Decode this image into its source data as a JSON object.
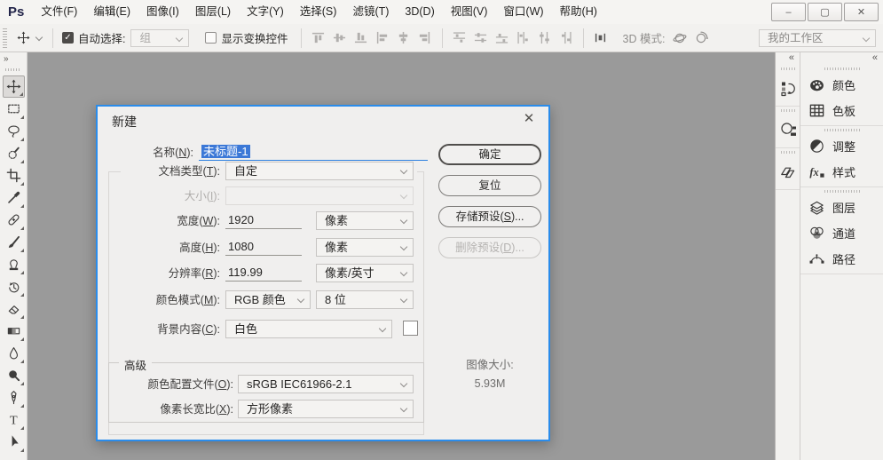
{
  "app": {
    "logo": "Ps"
  },
  "titlebar": {
    "menus": [
      {
        "id": "file",
        "label": "文件(F)"
      },
      {
        "id": "edit",
        "label": "编辑(E)"
      },
      {
        "id": "image",
        "label": "图像(I)"
      },
      {
        "id": "layer",
        "label": "图层(L)"
      },
      {
        "id": "type",
        "label": "文字(Y)"
      },
      {
        "id": "select",
        "label": "选择(S)"
      },
      {
        "id": "filter",
        "label": "滤镜(T)"
      },
      {
        "id": "3d",
        "label": "3D(D)"
      },
      {
        "id": "view",
        "label": "视图(V)"
      },
      {
        "id": "window",
        "label": "窗口(W)"
      },
      {
        "id": "help",
        "label": "帮助(H)"
      }
    ],
    "window_controls": {
      "minimize": "–",
      "maximize": "▢",
      "close": "✕"
    }
  },
  "options_bar": {
    "auto_select": {
      "label": "自动选择:",
      "checked": true,
      "checkmark": "✓"
    },
    "group_dropdown": {
      "value": "组",
      "disabled": true
    },
    "show_transform": {
      "label": "显示变换控件",
      "checked": false
    },
    "align_icons": [
      {
        "id": "align-top"
      },
      {
        "id": "align-vertical-center"
      },
      {
        "id": "align-bottom"
      },
      {
        "id": "align-left"
      },
      {
        "id": "align-horizontal-center"
      },
      {
        "id": "align-right"
      }
    ],
    "distribute_icons": [
      {
        "id": "distribute-top"
      },
      {
        "id": "distribute-vertical-center"
      },
      {
        "id": "distribute-bottom"
      },
      {
        "id": "distribute-left"
      },
      {
        "id": "distribute-horizontal-center"
      },
      {
        "id": "distribute-right"
      }
    ],
    "spacing_icon": {
      "id": "distribute-spacing"
    },
    "mode_3d_label": "3D 模式:",
    "mode_3d_icons": [
      {
        "id": "orbit-3d"
      },
      {
        "id": "roll-3d"
      }
    ],
    "workspace": {
      "value": "我的工作区"
    }
  },
  "toolbar": {
    "selected": "move",
    "tools": [
      {
        "id": "move"
      },
      {
        "id": "rectangular-marquee"
      },
      {
        "id": "lasso"
      },
      {
        "id": "quick-selection"
      },
      {
        "id": "crop"
      },
      {
        "id": "eyedropper"
      },
      {
        "id": "spot-healing-brush"
      },
      {
        "id": "brush"
      },
      {
        "id": "clone-stamp"
      },
      {
        "id": "history-brush"
      },
      {
        "id": "eraser"
      },
      {
        "id": "gradient"
      },
      {
        "id": "blur"
      },
      {
        "id": "dodge"
      },
      {
        "id": "pen"
      },
      {
        "id": "type"
      },
      {
        "id": "path-selection"
      }
    ]
  },
  "right_panels": {
    "collapsed_icons": [
      {
        "id": "history"
      },
      {
        "id": "3d"
      },
      {
        "id": "libraries"
      }
    ],
    "panel_groups": [
      [
        {
          "id": "color",
          "label": "颜色"
        },
        {
          "id": "swatches",
          "label": "色板"
        }
      ],
      [
        {
          "id": "adjustments",
          "label": "调整"
        },
        {
          "id": "styles",
          "label": "样式"
        }
      ],
      [
        {
          "id": "layers",
          "label": "图层"
        },
        {
          "id": "channels",
          "label": "通道"
        },
        {
          "id": "paths",
          "label": "路径"
        }
      ]
    ]
  },
  "dialog": {
    "title": "新建",
    "close": "✕",
    "fields": {
      "name": {
        "label": "名称(N):",
        "value": "未标题-1"
      },
      "doc_type": {
        "label": "文档类型(T):",
        "value": "自定"
      },
      "size": {
        "label": "大小(I):",
        "value": ""
      },
      "width": {
        "label": "宽度(W):",
        "value": "1920",
        "unit": "像素"
      },
      "height": {
        "label": "高度(H):",
        "value": "1080",
        "unit": "像素"
      },
      "resolution": {
        "label": "分辨率(R):",
        "value": "119.99",
        "unit": "像素/英寸"
      },
      "color_mode": {
        "label": "颜色模式(M):",
        "value": "RGB 颜色",
        "depth": "8 位"
      },
      "background": {
        "label": "背景内容(C):",
        "value": "白色"
      },
      "advanced_legend": "高级",
      "color_profile": {
        "label": "颜色配置文件(O):",
        "value": "sRGB IEC61966-2.1"
      },
      "pixel_aspect": {
        "label": "像素长宽比(X):",
        "value": "方形像素"
      }
    },
    "buttons": {
      "ok": "确定",
      "reset": "复位",
      "save_preset": "存储预设(S)...",
      "delete_preset": "删除预设(D)..."
    },
    "image_size": {
      "label": "图像大小:",
      "value": "5.93M"
    }
  },
  "colors": {
    "accent_blue": "#2a8ceb",
    "selection_blue": "#3b78d7",
    "canvas_gray": "#9a9a9a",
    "chrome_bg": "#f2f1ef"
  }
}
